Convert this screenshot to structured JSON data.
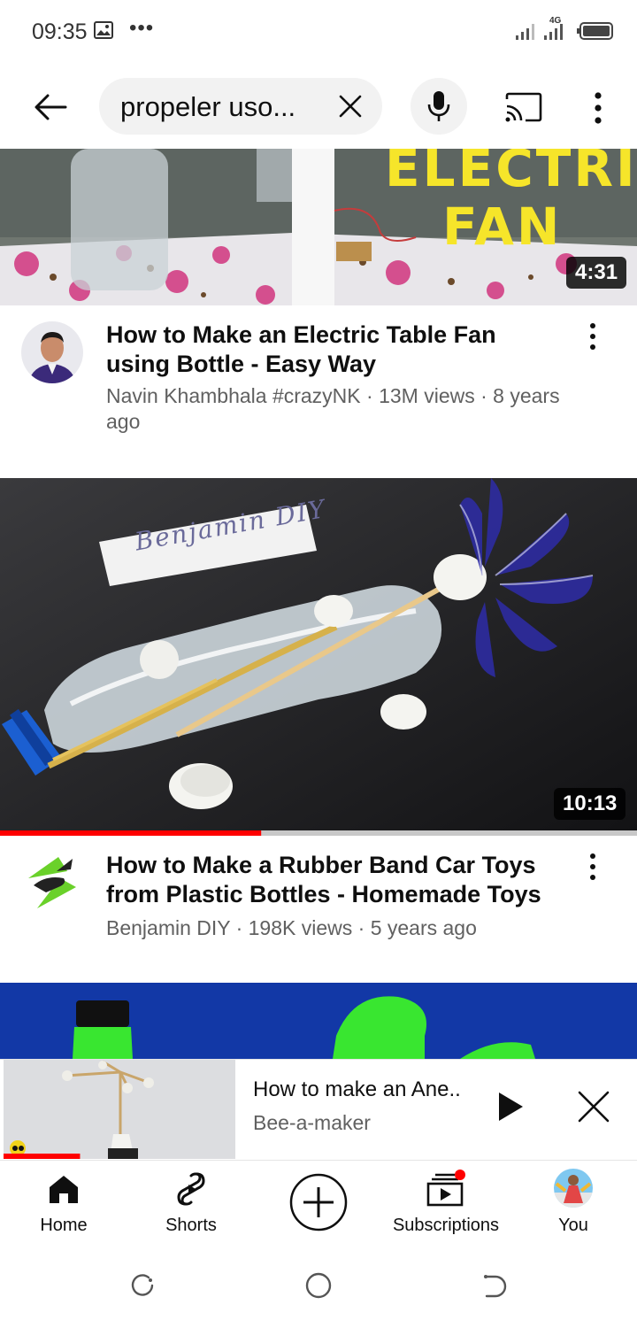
{
  "status_bar": {
    "time": "09:35",
    "more_glyph": "•••",
    "network_label": "4G"
  },
  "search": {
    "query": "propeler uso...",
    "icons": [
      "back-arrow-icon",
      "clear-icon",
      "mic-icon",
      "cast-icon",
      "more-vert-icon"
    ]
  },
  "videos": [
    {
      "duration": "4:31",
      "thumbnail_text": [
        "ELECTRIC",
        "FAN"
      ],
      "title": "How to Make an Electric Table Fan using Bottle - Easy Way",
      "meta": "Navin Khambhala #crazyNK · 13M views · 8 years ago"
    },
    {
      "duration": "10:13",
      "thumbnail_text": [
        "Benjamin DIY"
      ],
      "watched_progress": 0.41,
      "title": "How to Make a Rubber Band Car Toys from Plastic Bottles - Homemade Toys",
      "meta": "Benjamin DIY · 198K views · 5 years ago"
    }
  ],
  "mini_player": {
    "title": "How to make an Ane..",
    "channel": "Bee-a-maker",
    "progress": 0.33
  },
  "bottom_nav": {
    "home": "Home",
    "shorts": "Shorts",
    "subscriptions": "Subscriptions",
    "you": "You"
  },
  "colors": {
    "accent_red": "#ff0000",
    "text_primary": "#0f0f0f",
    "text_secondary": "#606060",
    "chip_bg": "#f2f2f2",
    "thumb3_blue": "#1238a6",
    "thumb3_green": "#39e630"
  }
}
